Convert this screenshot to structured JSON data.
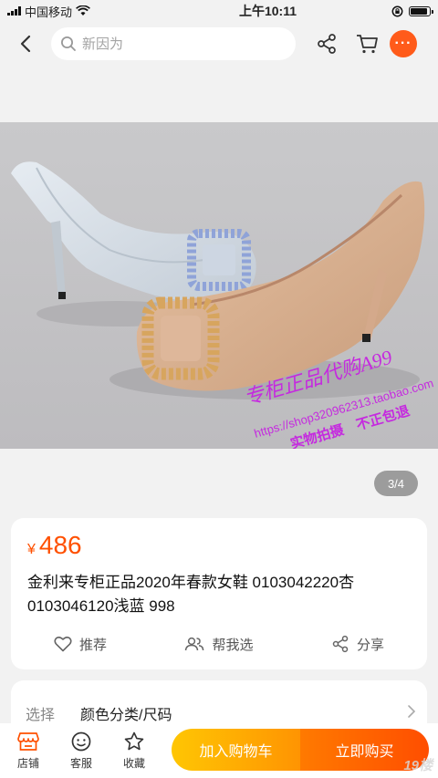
{
  "status_bar": {
    "carrier": "中国移动",
    "time": "上午10:11"
  },
  "nav": {
    "search_placeholder": "新因为",
    "more_label": "···"
  },
  "image": {
    "watermark_line1": "专柜正品代购A99",
    "watermark_line2": "https://shop320962313.taobao.com",
    "watermark_line3": "实物拍摄　不正包退",
    "counter": "3/4",
    "colors": {
      "bg": "#c7c7c9",
      "floor": "#b9b8bb",
      "shoe_gray": "#d6dde5",
      "shoe_nude": "#d9b395",
      "watermark": "#c52adf"
    }
  },
  "product": {
    "currency": "¥",
    "price": "486",
    "title": "金利来专柜正品2020年春款女鞋 0103042220杏 0103046120浅蓝 998",
    "actions": [
      {
        "label": "推荐",
        "icon": "heart-icon"
      },
      {
        "label": "帮我选",
        "icon": "people-icon"
      },
      {
        "label": "分享",
        "icon": "share-icon"
      }
    ]
  },
  "spec": {
    "label": "选择",
    "value": "颜色分类/尺码"
  },
  "bottom_bar": {
    "tabs": [
      {
        "label": "店铺",
        "icon": "store-icon"
      },
      {
        "label": "客服",
        "icon": "service-icon"
      },
      {
        "label": "收藏",
        "icon": "star-icon"
      }
    ],
    "add_cart": "加入购物车",
    "buy_now": "立即购买",
    "watermark": "19楼"
  },
  "colors": {
    "accent": "#ff5000",
    "cart_btn": "#ffa800",
    "buy_btn": "#ff5a00"
  }
}
